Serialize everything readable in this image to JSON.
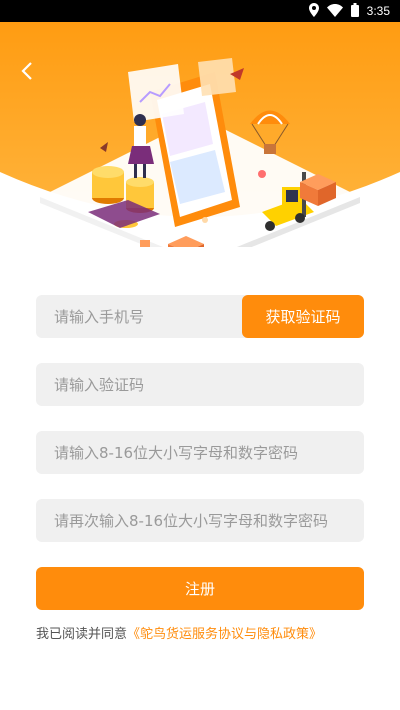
{
  "status_bar": {
    "time": "3:35"
  },
  "form": {
    "phone_placeholder": "请输入手机号",
    "get_code_label": "获取验证码",
    "code_placeholder": "请输入验证码",
    "password_placeholder": "请输入8-16位大小写字母和数字密码",
    "confirm_placeholder": "请再次输入8-16位大小写字母和数字密码"
  },
  "register_label": "注册",
  "agreement": {
    "prefix": "我已阅读并同意",
    "link": "《鸵鸟货运服务协议与隐私政策》"
  },
  "colors": {
    "accent": "#ff8c0c",
    "header_top": "#ff9c12",
    "field_bg": "#f0f0f0"
  }
}
